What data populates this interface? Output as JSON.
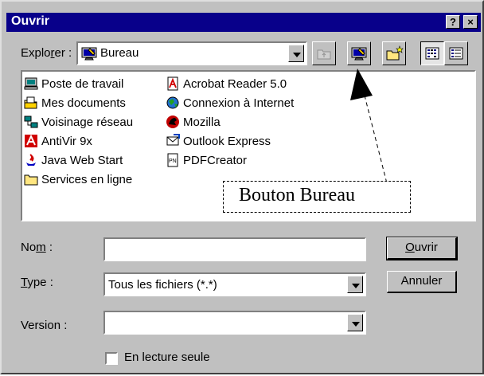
{
  "titlebar": {
    "title": "Ouvrir",
    "help_glyph": "?",
    "close_glyph": "×"
  },
  "look_in": {
    "label_pre": "Explo",
    "label_hot": "r",
    "label_post": "er :",
    "value": "Bureau",
    "icon": "desktop-icon"
  },
  "toolbar": {
    "buttons": [
      {
        "name": "up-folder-button",
        "icon": "up-folder-icon"
      },
      {
        "name": "desktop-button",
        "icon": "desktop-icon"
      },
      {
        "name": "new-folder-button",
        "icon": "new-folder-icon"
      },
      {
        "name": "list-view-button",
        "icon": "list-view-icon"
      },
      {
        "name": "details-view-button",
        "icon": "details-view-icon"
      }
    ]
  },
  "files": {
    "col1": [
      {
        "label": "Poste de travail",
        "icon": "computer-icon"
      },
      {
        "label": "Mes documents",
        "icon": "documents-folder-icon"
      },
      {
        "label": "Voisinage réseau",
        "icon": "network-icon"
      },
      {
        "label": "AntiVir 9x",
        "icon": "antivir-icon"
      },
      {
        "label": "Java Web Start",
        "icon": "java-icon"
      },
      {
        "label": "Services en ligne",
        "icon": "folder-icon"
      }
    ],
    "col2": [
      {
        "label": "Acrobat Reader 5.0",
        "icon": "acrobat-icon"
      },
      {
        "label": "Connexion à Internet",
        "icon": "internet-connection-icon"
      },
      {
        "label": "Mozilla",
        "icon": "mozilla-icon"
      },
      {
        "label": "Outlook Express",
        "icon": "outlook-express-icon"
      },
      {
        "label": "PDFCreator",
        "icon": "pdfcreator-icon"
      }
    ]
  },
  "annotation": {
    "text": "Bouton Bureau"
  },
  "fields": {
    "name": {
      "label_pre": "No",
      "label_hot": "m",
      "label_post": " :",
      "value": ""
    },
    "type": {
      "label_pre": "",
      "label_hot": "T",
      "label_post": "ype :",
      "value": "Tous les fichiers (*.*)"
    },
    "version": {
      "label": "Version :",
      "value": ""
    },
    "readonly": {
      "label": "En lecture seule",
      "checked": false
    }
  },
  "buttons": {
    "open": {
      "label_hot": "O",
      "label_rest": "uvrir"
    },
    "cancel": {
      "label": "Annuler"
    }
  },
  "colors": {
    "titlebar": "#08008a",
    "face": "#c0c0c0"
  }
}
